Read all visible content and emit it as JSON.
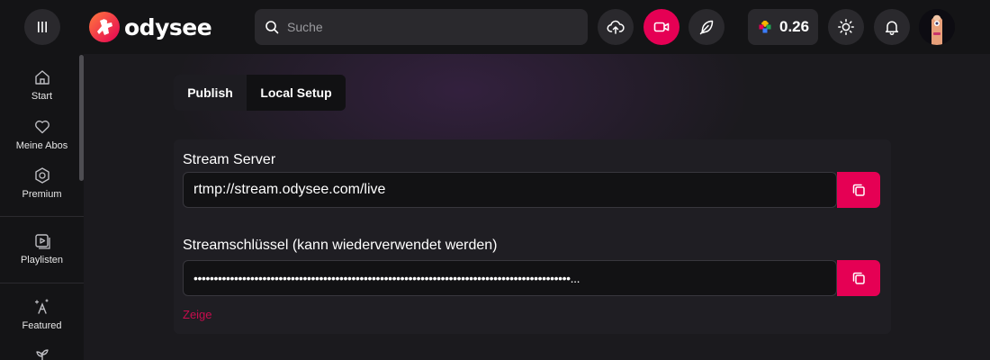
{
  "header": {
    "logo_text": "odysee",
    "search": {
      "placeholder": "Suche",
      "value": ""
    },
    "credits": "0.26"
  },
  "sidebar": {
    "items": [
      {
        "label": "Start",
        "icon": "home-icon"
      },
      {
        "label": "Meine Abos",
        "icon": "heart-icon"
      },
      {
        "label": "Premium",
        "icon": "premium-icon"
      },
      {
        "label": "Playlisten",
        "icon": "playlist-icon"
      },
      {
        "label": "Featured",
        "icon": "featured-icon"
      },
      {
        "label": "",
        "icon": "plant-icon"
      }
    ]
  },
  "tabs": [
    {
      "label": "Publish",
      "active": false
    },
    {
      "label": "Local Setup",
      "active": true
    }
  ],
  "stream_server": {
    "label": "Stream Server",
    "value": "rtmp://stream.odysee.com/live"
  },
  "stream_key": {
    "label": "Streamschlüssel (kann wiederverwendet werden)",
    "value": "•••••••••••••••••••••••••••••••••••••••••••••••••••••••••••••••••••••••••••••••••••••••••••••..."
  },
  "show_link": "Zeige",
  "colors": {
    "accent": "#e50054",
    "background": "#1b1a1e",
    "header": "#141416",
    "card": "#1f1e23"
  }
}
